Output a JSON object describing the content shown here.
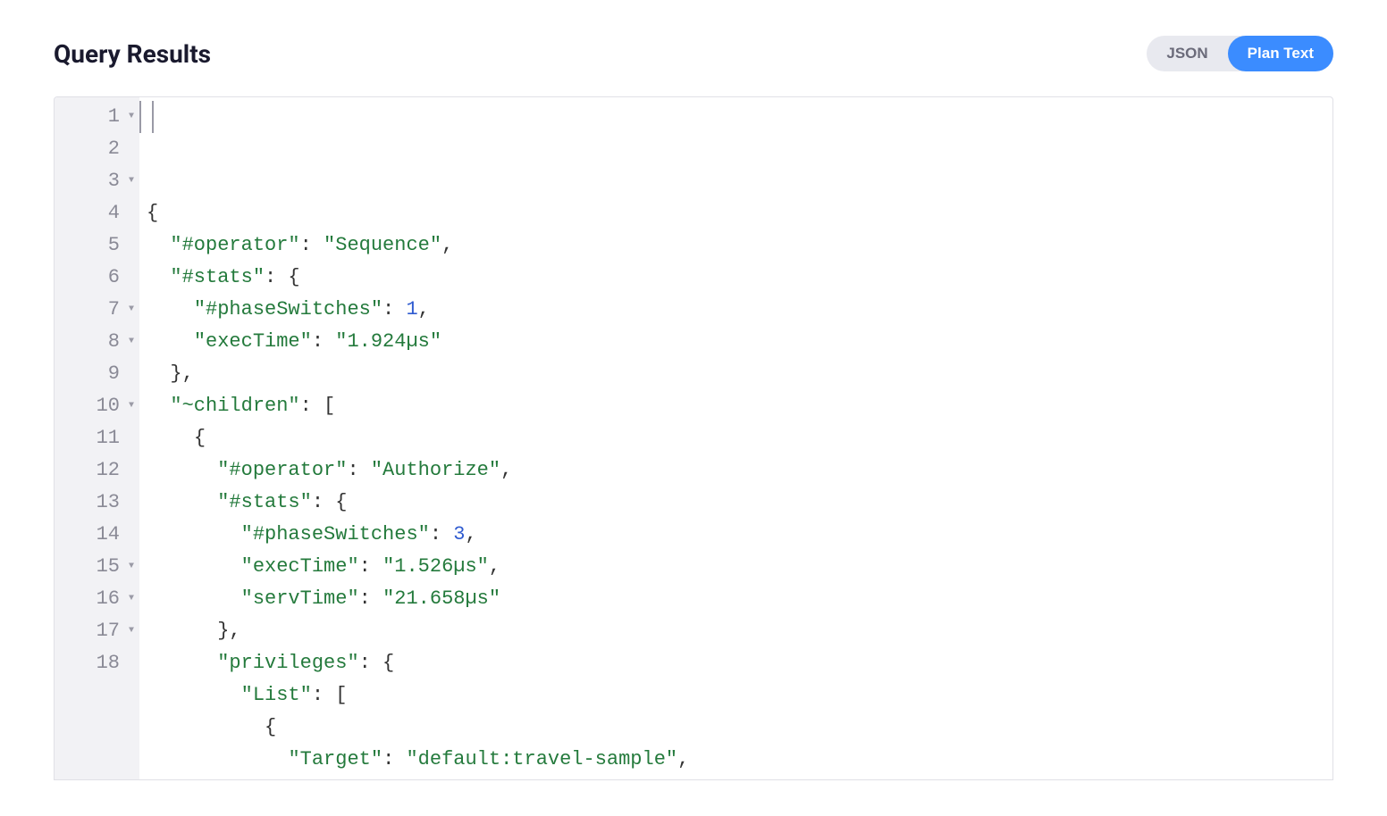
{
  "header": {
    "title": "Query Results",
    "tabs": [
      {
        "label": "JSON",
        "active": false
      },
      {
        "label": "Plan Text",
        "active": true
      }
    ]
  },
  "editor": {
    "lines": [
      {
        "n": "1",
        "fold": true,
        "html": "<span class='punc'>{</span>"
      },
      {
        "n": "2",
        "fold": false,
        "html": "  <span class='key'>\"#operator\"</span><span class='punc'>: </span><span class='str'>\"Sequence\"</span><span class='punc'>,</span>"
      },
      {
        "n": "3",
        "fold": true,
        "html": "  <span class='key'>\"#stats\"</span><span class='punc'>: {</span>"
      },
      {
        "n": "4",
        "fold": false,
        "html": "    <span class='key'>\"#phaseSwitches\"</span><span class='punc'>: </span><span class='num'>1</span><span class='punc'>,</span>"
      },
      {
        "n": "5",
        "fold": false,
        "html": "    <span class='key'>\"execTime\"</span><span class='punc'>: </span><span class='str'>\"1.924µs\"</span>"
      },
      {
        "n": "6",
        "fold": false,
        "html": "  <span class='punc'>},</span>"
      },
      {
        "n": "7",
        "fold": true,
        "html": "  <span class='key'>\"~children\"</span><span class='punc'>: [</span>"
      },
      {
        "n": "8",
        "fold": true,
        "html": "    <span class='punc'>{</span>"
      },
      {
        "n": "9",
        "fold": false,
        "html": "      <span class='key'>\"#operator\"</span><span class='punc'>: </span><span class='str'>\"Authorize\"</span><span class='punc'>,</span>"
      },
      {
        "n": "10",
        "fold": true,
        "html": "      <span class='key'>\"#stats\"</span><span class='punc'>: {</span>"
      },
      {
        "n": "11",
        "fold": false,
        "html": "        <span class='key'>\"#phaseSwitches\"</span><span class='punc'>: </span><span class='num'>3</span><span class='punc'>,</span>"
      },
      {
        "n": "12",
        "fold": false,
        "html": "        <span class='key'>\"execTime\"</span><span class='punc'>: </span><span class='str'>\"1.526µs\"</span><span class='punc'>,</span>"
      },
      {
        "n": "13",
        "fold": false,
        "html": "        <span class='key'>\"servTime\"</span><span class='punc'>: </span><span class='str'>\"21.658µs\"</span>"
      },
      {
        "n": "14",
        "fold": false,
        "html": "      <span class='punc'>},</span>"
      },
      {
        "n": "15",
        "fold": true,
        "html": "      <span class='key'>\"privileges\"</span><span class='punc'>: {</span>"
      },
      {
        "n": "16",
        "fold": true,
        "html": "        <span class='key'>\"List\"</span><span class='punc'>: [</span>"
      },
      {
        "n": "17",
        "fold": true,
        "html": "          <span class='punc'>{</span>"
      },
      {
        "n": "18",
        "fold": false,
        "html": "            <span class='key'>\"Target\"</span><span class='punc'>: </span><span class='str'>\"default:travel-sample\"</span><span class='punc'>,</span>"
      }
    ]
  },
  "query_plan": {
    "#operator": "Sequence",
    "#stats": {
      "#phaseSwitches": 1,
      "execTime": "1.924µs"
    },
    "~children": [
      {
        "#operator": "Authorize",
        "#stats": {
          "#phaseSwitches": 3,
          "execTime": "1.526µs",
          "servTime": "21.658µs"
        },
        "privileges": {
          "List": [
            {
              "Target": "default:travel-sample"
            }
          ]
        }
      }
    ]
  }
}
